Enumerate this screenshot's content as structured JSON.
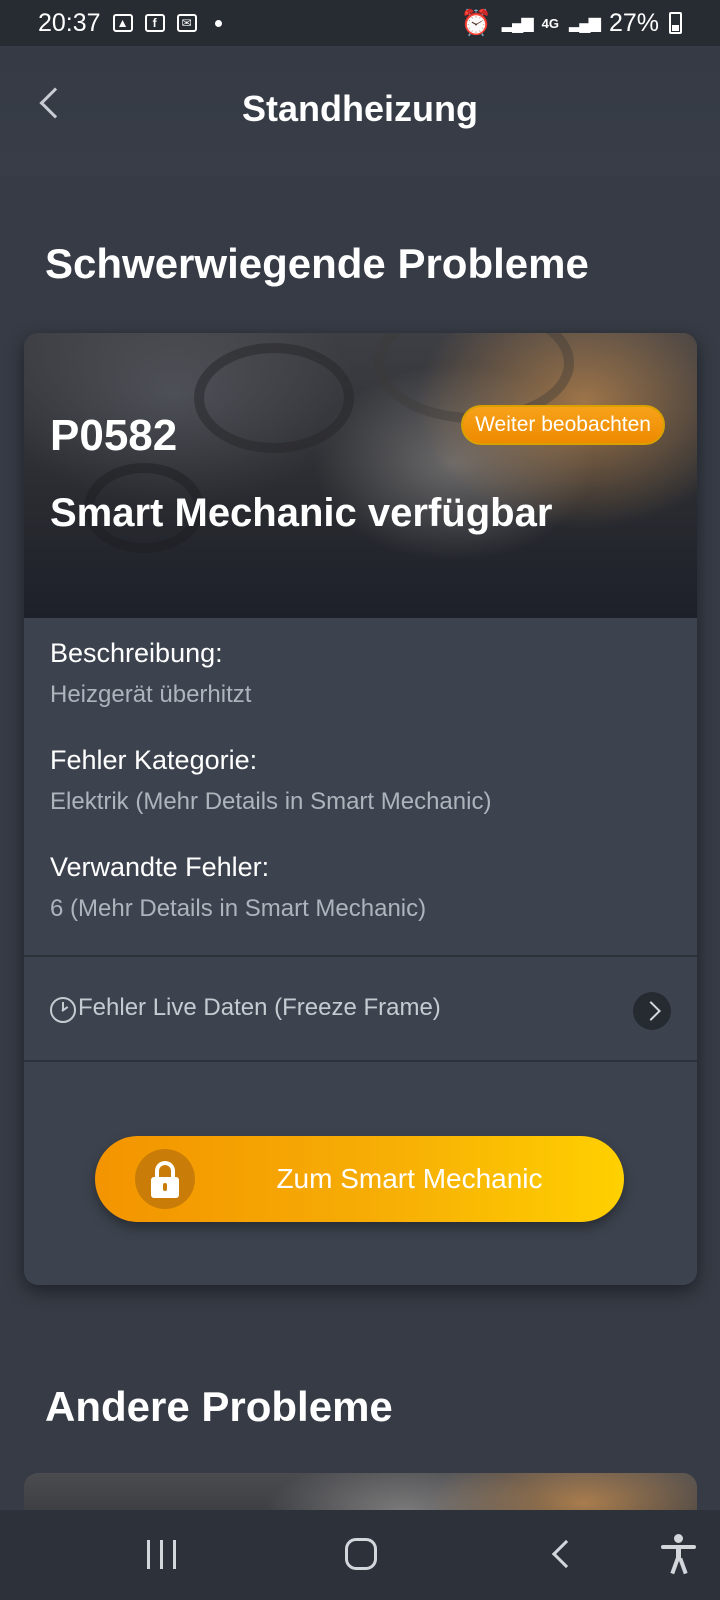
{
  "status_bar": {
    "time": "20:37",
    "network": "4G",
    "battery": "27%"
  },
  "header": {
    "title": "Standheizung"
  },
  "sections": {
    "serious_title": "Schwerwiegende Probleme",
    "other_title": "Andere Probleme"
  },
  "problem_card": {
    "code": "P0582",
    "badge": "Weiter beobachten",
    "subtitle": "Smart Mechanic verfügbar",
    "description_label": "Beschreibung:",
    "description_value": "Heizgerät überhitzt",
    "category_label": "Fehler Kategorie:",
    "category_value": "Elektrik  (Mehr Details in Smart Mechanic)",
    "related_label": "Verwandte Fehler:",
    "related_value": "6  (Mehr Details in Smart Mechanic)",
    "freeze_frame_label": "Fehler Live Daten (Freeze Frame)",
    "cta_label": "Zum Smart Mechanic"
  },
  "colors": {
    "background": "#363b45",
    "card": "#3d434e",
    "accent_orange": "#f39400",
    "accent_yellow": "#ffd000",
    "muted_text": "#aeb3bc"
  },
  "icons": {
    "back": "back-chevron-icon",
    "clock": "clock-icon",
    "chevron": "chevron-right-icon",
    "lock": "lock-icon"
  }
}
